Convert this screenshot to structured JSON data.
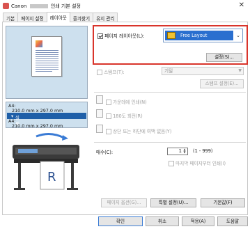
{
  "window": {
    "title_prefix": "Canon",
    "title_suffix": "인쇄 기본 설정",
    "close_glyph": "✕"
  },
  "tabs": [
    {
      "label": "기본"
    },
    {
      "label": "페이지 설정"
    },
    {
      "label": "레이아웃"
    },
    {
      "label": "즐겨찾기"
    },
    {
      "label": "유지 관리"
    }
  ],
  "active_tab_index": 2,
  "preview": {
    "media_lines": [
      "A4:",
      "210.0 mm x 297.0 mm",
      "실제 크기",
      "A4:",
      "210.0 mm x 297.0 mm"
    ],
    "selected_line": "실제 크기",
    "media_icon": "media-size-icon"
  },
  "page_layout": {
    "checkbox_label": "페이지 레이아웃(L):",
    "checked": true,
    "selected_value": "Free Layout",
    "settings_button": "설정(S)..."
  },
  "stamp": {
    "label": "스탬프(T):",
    "value": "기밀",
    "settings_button": "스탬프 설정(E)..."
  },
  "options": {
    "center": "가운데에 인쇄(N)",
    "rotate": "180도 회전(R)",
    "margin": "상단 또는 하단에 여백 없음(Y)"
  },
  "copies": {
    "label": "매수(C):",
    "value": "1",
    "range": "(1 - 999)",
    "reverse_label": "마지막 페이지부터 인쇄(I)"
  },
  "bottom_buttons": {
    "page_options": "페이지 옵션(G)...",
    "special": "특별 설정(U)...",
    "defaults": "기본값(F)"
  },
  "footer": {
    "ok": "확인",
    "cancel": "취소",
    "apply": "적용(A)",
    "help": "도움말"
  },
  "colors": {
    "highlight_border": "#d9342b",
    "selection": "#2a6fcf",
    "preview_bg": "#cde0ee"
  }
}
